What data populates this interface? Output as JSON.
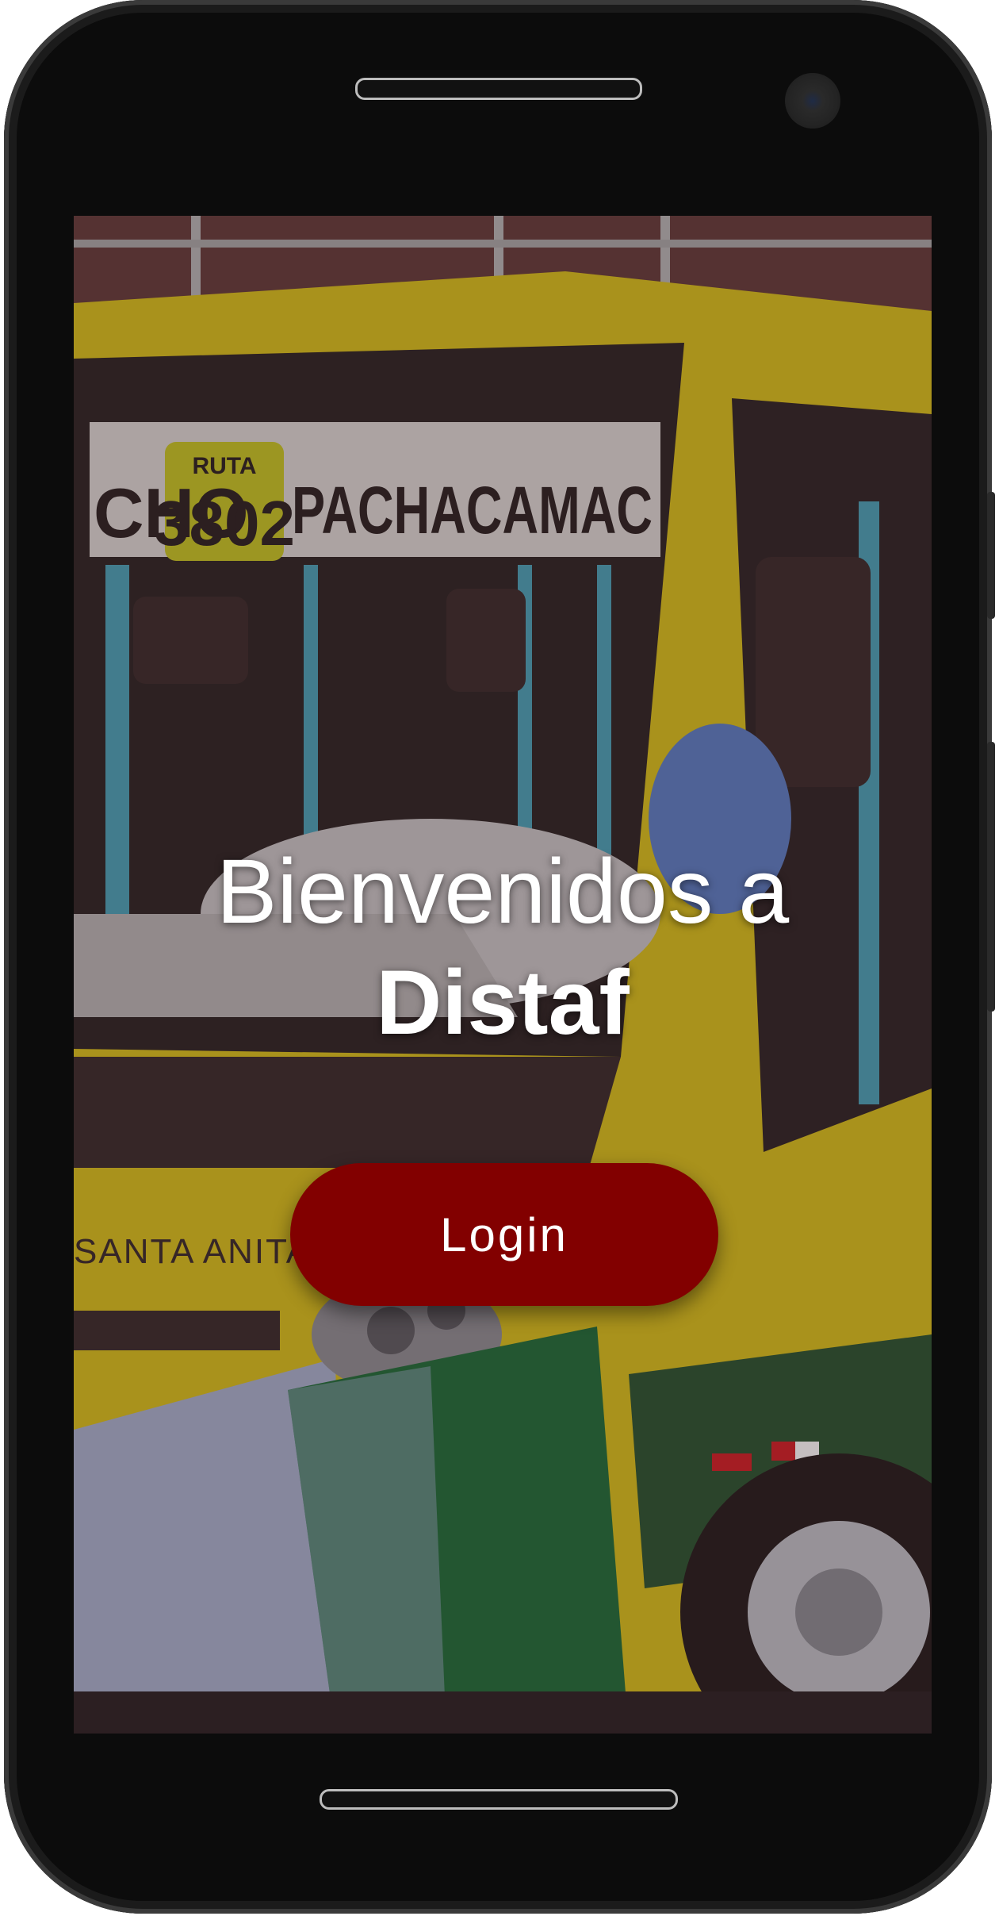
{
  "screen": {
    "welcome_line1": "Bienvenidos a",
    "welcome_line2": "Distaf",
    "login_label": "Login"
  },
  "background_photo": {
    "route_label": "RUTA",
    "route_number": "3802",
    "destination_left": "CHO",
    "destination": "PACHACAMAC",
    "side_text": "SANTA ANITA"
  },
  "colors": {
    "accent": "#820000",
    "bus_yellow": "#e6cf1e",
    "bus_green": "#1f6e3a",
    "text": "#ffffff"
  }
}
